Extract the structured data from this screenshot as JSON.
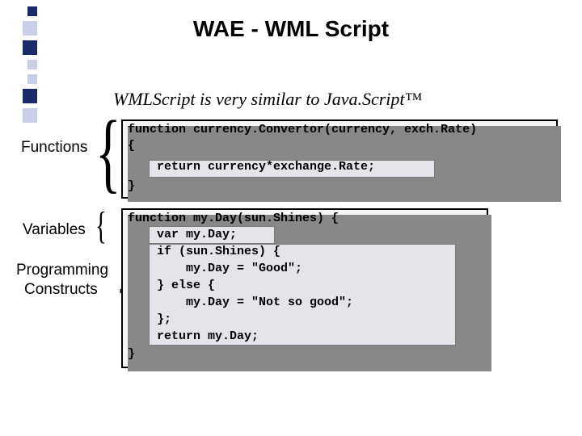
{
  "title": "WAE - WML Script",
  "subtitle": "WMLScript is very similar to Java.Script™",
  "labels": {
    "functions": "Functions",
    "variables": "Variables",
    "programming": "Programming",
    "constructs": "Constructs"
  },
  "code1": {
    "l1": "function currency.Convertor(currency, exch.Rate)",
    "l2": "{",
    "l3": "    return currency*exchange.Rate;",
    "l4": "}"
  },
  "code2": {
    "l1": "function my.Day(sun.Shines) {",
    "l2": "    var my.Day;",
    "l3": "    if (sun.Shines) {",
    "l4": "        my.Day = \"Good\";",
    "l5": "    } else {",
    "l6": "        my.Day = \"Not so good\";",
    "l7": "    };",
    "l8": "    return my.Day;",
    "l9": "}"
  }
}
